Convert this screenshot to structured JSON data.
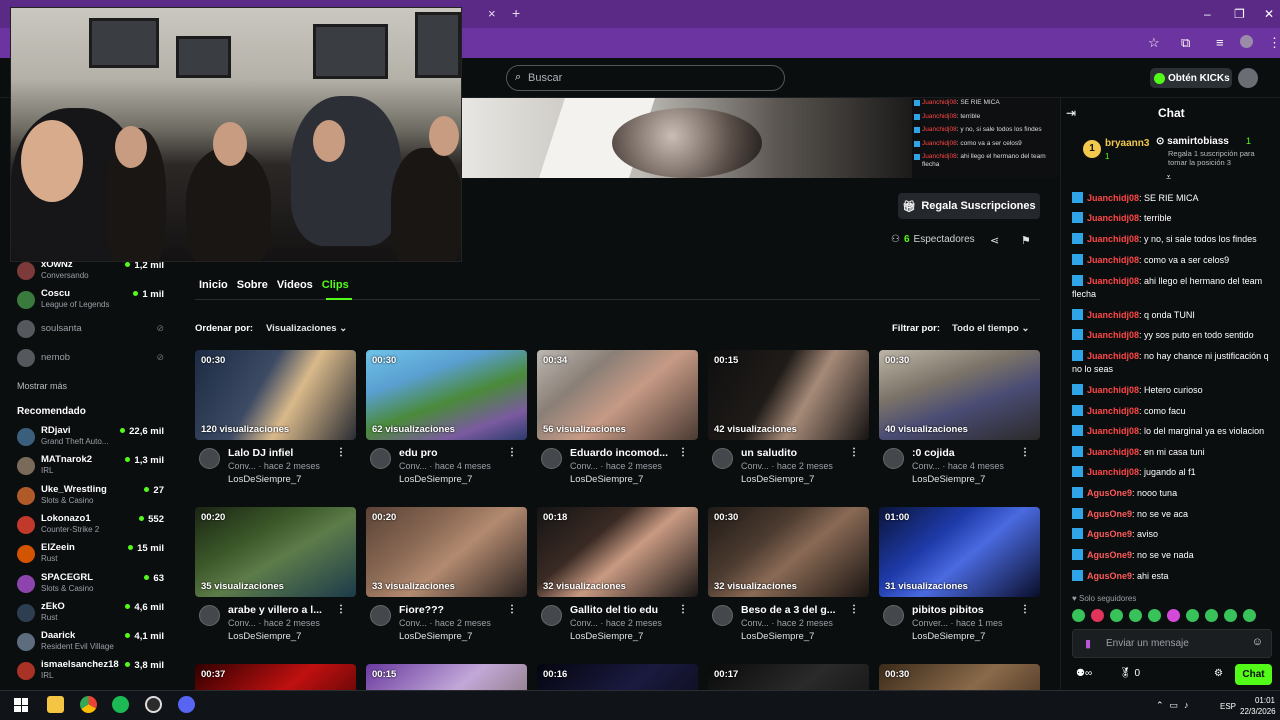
{
  "browser": {
    "tab_close": "×",
    "new_tab": "+",
    "win_min": "–",
    "win_max": "❐",
    "win_close": "✕",
    "toolbar_icons": [
      "star-icon",
      "extensions-icon",
      "media-icon",
      "profile-icon",
      "menu-icon"
    ]
  },
  "header": {
    "search_placeholder": "Buscar",
    "kicks_label": "Obtén KICKs"
  },
  "banner_chat": [
    {
      "user": "Juanchidj08",
      "text": "SE RIE MICA"
    },
    {
      "user": "Juanchidj08",
      "text": "terrible"
    },
    {
      "user": "Juanchidj08",
      "text": "y no, si sale todos los findes"
    },
    {
      "user": "Juanchidj08",
      "text": "como va a ser celos9"
    },
    {
      "user": "Juanchidj08",
      "text": "ahi llego el hermano del team flecha"
    }
  ],
  "channel": {
    "gift_label": "Regala Suscripciones",
    "viewers_count": "6",
    "viewers_label": "Espectadores"
  },
  "sidebar": {
    "following": [
      {
        "name": "xOwNz",
        "category": "Conversando",
        "viewers": "1,2 mil",
        "avatar": "#7d3a3a"
      },
      {
        "name": "Coscu",
        "category": "League of Legends",
        "viewers": "1 mil",
        "avatar": "#3b7a3d"
      },
      {
        "name": "soulsanta",
        "offline": true,
        "avatar": "#55585c"
      },
      {
        "name": "nemob",
        "offline": true,
        "avatar": "#55585c"
      }
    ],
    "show_more": "Mostrar más",
    "recommended_title": "Recomendado",
    "recommended": [
      {
        "name": "RDjavi",
        "category": "Grand Theft Auto...",
        "viewers": "22,6 mil",
        "avatar": "#3a5f7d"
      },
      {
        "name": "MATnarok2",
        "category": "IRL",
        "viewers": "1,3 mil",
        "avatar": "#7a6a5a"
      },
      {
        "name": "Uke_Wrestling",
        "category": "Slots & Casino",
        "viewers": "27",
        "avatar": "#b05a2a"
      },
      {
        "name": "Lokonazo1",
        "category": "Counter-Strike 2",
        "viewers": "552",
        "avatar": "#c0392b"
      },
      {
        "name": "ElZeein",
        "category": "Rust",
        "viewers": "15 mil",
        "avatar": "#d35400"
      },
      {
        "name": "SPACEGRL",
        "category": "Slots & Casino",
        "viewers": "63",
        "avatar": "#8e44ad"
      },
      {
        "name": "zEkO",
        "category": "Rust",
        "viewers": "4,6 mil",
        "avatar": "#2c3e50"
      },
      {
        "name": "Daarick",
        "category": "Resident Evil Village",
        "viewers": "4,1 mil",
        "avatar": "#5d6d7e"
      },
      {
        "name": "ismaelsanchez18",
        "category": "IRL",
        "viewers": "3,8 mil",
        "avatar": "#a93226"
      }
    ]
  },
  "tabs": [
    "Inicio",
    "Sobre",
    "Videos",
    "Clips"
  ],
  "sort": {
    "label": "Ordenar por:",
    "value": "Visualizaciones"
  },
  "filter": {
    "label": "Filtrar por:",
    "value": "Todo el tiempo"
  },
  "clips": [
    {
      "duration": "00:30",
      "views": "120 visualizaciones",
      "title": "Lalo DJ infiel",
      "meta": "Conv... · hace 2 meses",
      "author": "LosDeSiempre_7",
      "thumb": "linear-gradient(120deg,#1c2c44 0%,#3c4a63 40%,#d9b98a 60%,#2a2c33 100%)"
    },
    {
      "duration": "00:30",
      "views": "62 visualizaciones",
      "title": "edu pro",
      "meta": "Conv... · hace 4 meses",
      "author": "LosDeSiempre_7",
      "thumb": "linear-gradient(160deg,#6ec3ea 0%,#5a9fd0 30%,#4a8a3a 55%,#7a5aa0 80%,#2a3a6a 100%)"
    },
    {
      "duration": "00:34",
      "views": "56 visualizaciones",
      "title": "Eduardo incomod...",
      "meta": "Conv... · hace 2 meses",
      "author": "LosDeSiempre_7",
      "thumb": "linear-gradient(140deg,#bbb7b0 0%,#8a7f77 30%,#c69a85 55%,#4a3a33 100%)"
    },
    {
      "duration": "00:15",
      "views": "42 visualizaciones",
      "title": "un saludito",
      "meta": "Conv... · hace 2 meses",
      "author": "LosDeSiempre_7",
      "thumb": "linear-gradient(120deg,#0f0f10 0%,#1f1b18 40%,#a68a78 60%,#151313 100%)"
    },
    {
      "duration": "00:30",
      "views": "40 visualizaciones",
      "title": ":0 cojida",
      "meta": "Conv... · hace 4 meses",
      "author": "LosDeSiempre_7",
      "thumb": "linear-gradient(160deg,#bdb6a8 0%,#7c7468 35%,#4a4c74 60%,#2b2a2a 100%)"
    },
    {
      "duration": "00:20",
      "views": "35 visualizaciones",
      "title": "arabe y villero a l...",
      "meta": "Conv... · hace 2 meses",
      "author": "LosDeSiempre_7",
      "thumb": "linear-gradient(150deg,#1a2414 0%,#3d5a2a 35%,#5d7c4a 55%,#1c3a4a 100%)"
    },
    {
      "duration": "00:20",
      "views": "33 visualizaciones",
      "title": "Fiore???",
      "meta": "Conv... · hace 2 meses",
      "author": "LosDeSiempre_7",
      "thumb": "linear-gradient(140deg,#5a4236 0%,#8b6a55 35%,#b38a70 55%,#2b2320 100%)"
    },
    {
      "duration": "00:18",
      "views": "32 visualizaciones",
      "title": "Gallito del tio edu",
      "meta": "Conv... · hace 2 meses",
      "author": "LosDeSiempre_7",
      "thumb": "linear-gradient(140deg,#141414 0%,#3a2a24 35%,#c99a82 55%,#1a1716 100%)"
    },
    {
      "duration": "00:30",
      "views": "32 visualizaciones",
      "title": "Beso de a 3 del g...",
      "meta": "Conv... · hace 2 meses",
      "author": "LosDeSiempre_7",
      "thumb": "linear-gradient(140deg,#1f1a16 0%,#4c3b30 35%,#8a6a55 55%,#1a1512 100%)"
    },
    {
      "duration": "01:00",
      "views": "31 visualizaciones",
      "title": "pibitos pibitos",
      "meta": "Conver... · hace 1 mes",
      "author": "LosDeSiempre_7",
      "thumb": "linear-gradient(140deg,#0a1438 0%,#1e3aa8 35%,#4a6ae0 55%,#0a0e2a 100%)"
    },
    {
      "duration": "00:37",
      "views": "",
      "title": "",
      "meta": "",
      "author": "",
      "thumb": "linear-gradient(140deg,#300000 0%,#c01010 45%,#200000 100%)"
    },
    {
      "duration": "00:15",
      "views": "",
      "title": "",
      "meta": "",
      "author": "",
      "thumb": "linear-gradient(140deg,#6a3aa0 0%,#c2a8d8 45%,#6a5a4a 100%)"
    },
    {
      "duration": "00:16",
      "views": "",
      "title": "",
      "meta": "",
      "author": "",
      "thumb": "linear-gradient(140deg,#050510 0%,#1a1a40 45%,#050508 100%)"
    },
    {
      "duration": "00:17",
      "views": "",
      "title": "",
      "meta": "",
      "author": "",
      "thumb": "linear-gradient(140deg,#0a0a0a 0%,#2a2a2a 45%,#0a0a0a 100%)"
    },
    {
      "duration": "00:30",
      "views": "",
      "title": "",
      "meta": "",
      "author": "",
      "thumb": "linear-gradient(140deg,#3a2a1a 0%,#8a6a4a 45%,#2a1a10 100%)"
    }
  ],
  "chat": {
    "title": "Chat",
    "leaderboard": {
      "rank1_name": "bryaann3",
      "rank1_count": "1",
      "rank2_name": "samirtobiass",
      "rank2_count": "1",
      "promo": "Regala 1 suscripción para tomar la posición 3"
    },
    "messages": [
      {
        "user": "Juanchidj08",
        "color": "#ff4646",
        "text": "SE RIE MICA"
      },
      {
        "user": "Juanchidj08",
        "color": "#ff4646",
        "text": "terrible"
      },
      {
        "user": "Juanchidj08",
        "color": "#ff4646",
        "text": "y no, si sale todos los findes"
      },
      {
        "user": "Juanchidj08",
        "color": "#ff4646",
        "text": "como va a ser celos9"
      },
      {
        "user": "Juanchidj08",
        "color": "#ff4646",
        "text": "ahi llego el hermano del team flecha"
      },
      {
        "user": "Juanchidj08",
        "color": "#ff4646",
        "text": "q onda TUNI"
      },
      {
        "user": "Juanchidj08",
        "color": "#ff4646",
        "text": "yy sos puto en todo sentido"
      },
      {
        "user": "Juanchidj08",
        "color": "#ff4646",
        "text": "no hay chance ni justificación q no lo seas"
      },
      {
        "user": "Juanchidj08",
        "color": "#ff4646",
        "text": "Hetero curioso"
      },
      {
        "user": "Juanchidj08",
        "color": "#ff4646",
        "text": "como facu"
      },
      {
        "user": "Juanchidj08",
        "color": "#ff4646",
        "text": "lo del marginal ya es violacion"
      },
      {
        "user": "Juanchidj08",
        "color": "#ff4646",
        "text": "en mi casa tuni"
      },
      {
        "user": "Juanchidj08",
        "color": "#ff4646",
        "text": "jugando al f1"
      },
      {
        "user": "AgusOne9",
        "color": "#ff5a5a",
        "text": "nooo tuna"
      },
      {
        "user": "AgusOne9",
        "color": "#ff5a5a",
        "text": "no se ve aca"
      },
      {
        "user": "AgusOne9",
        "color": "#ff5a5a",
        "text": "aviso"
      },
      {
        "user": "AgusOne9",
        "color": "#ff5a5a",
        "text": "no se ve nada"
      },
      {
        "user": "AgusOne9",
        "color": "#ff5a5a",
        "text": "ahi esta"
      }
    ],
    "followers_only": "Solo seguidores",
    "input_placeholder": "Enviar un mensaje",
    "points": "0",
    "send_label": "Chat"
  },
  "taskbar": {
    "lang": "ESP",
    "time": "01:01",
    "date": "22/3/2026"
  }
}
